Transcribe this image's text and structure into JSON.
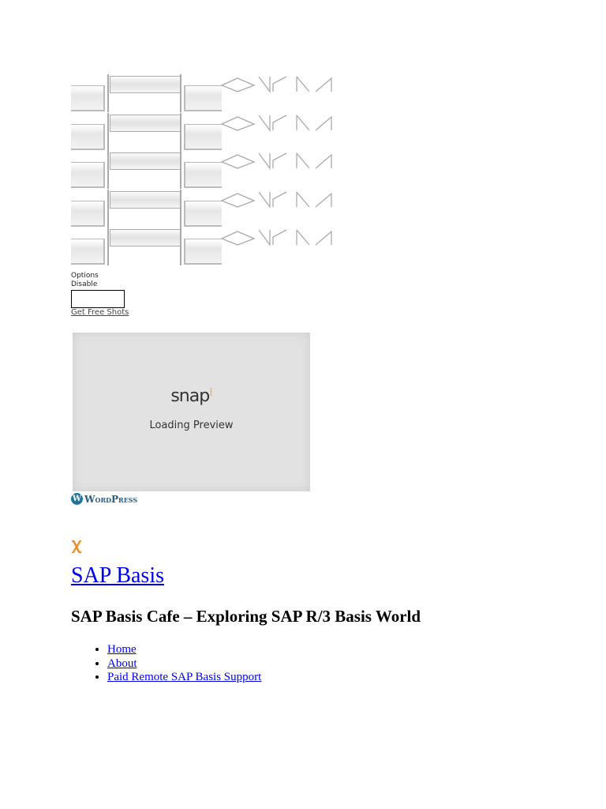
{
  "widget": {
    "options_label": "Options",
    "disable_label": "Disable",
    "get_free_shots": "Get Free Shots"
  },
  "preview": {
    "logo_text": "snap",
    "loading_text": "Loading Preview",
    "accent_color": "#f5a01a"
  },
  "footer_badge": {
    "wordpress_text": "WordPress"
  },
  "site": {
    "ribbon_icon": "awareness-ribbon-icon",
    "title": "SAP Basis",
    "tagline": "SAP Basis Cafe – Exploring SAP R/3 Basis World"
  },
  "nav": {
    "items": [
      {
        "label": "Home"
      },
      {
        "label": "About"
      },
      {
        "label": "Paid Remote SAP Basis Support"
      }
    ]
  }
}
